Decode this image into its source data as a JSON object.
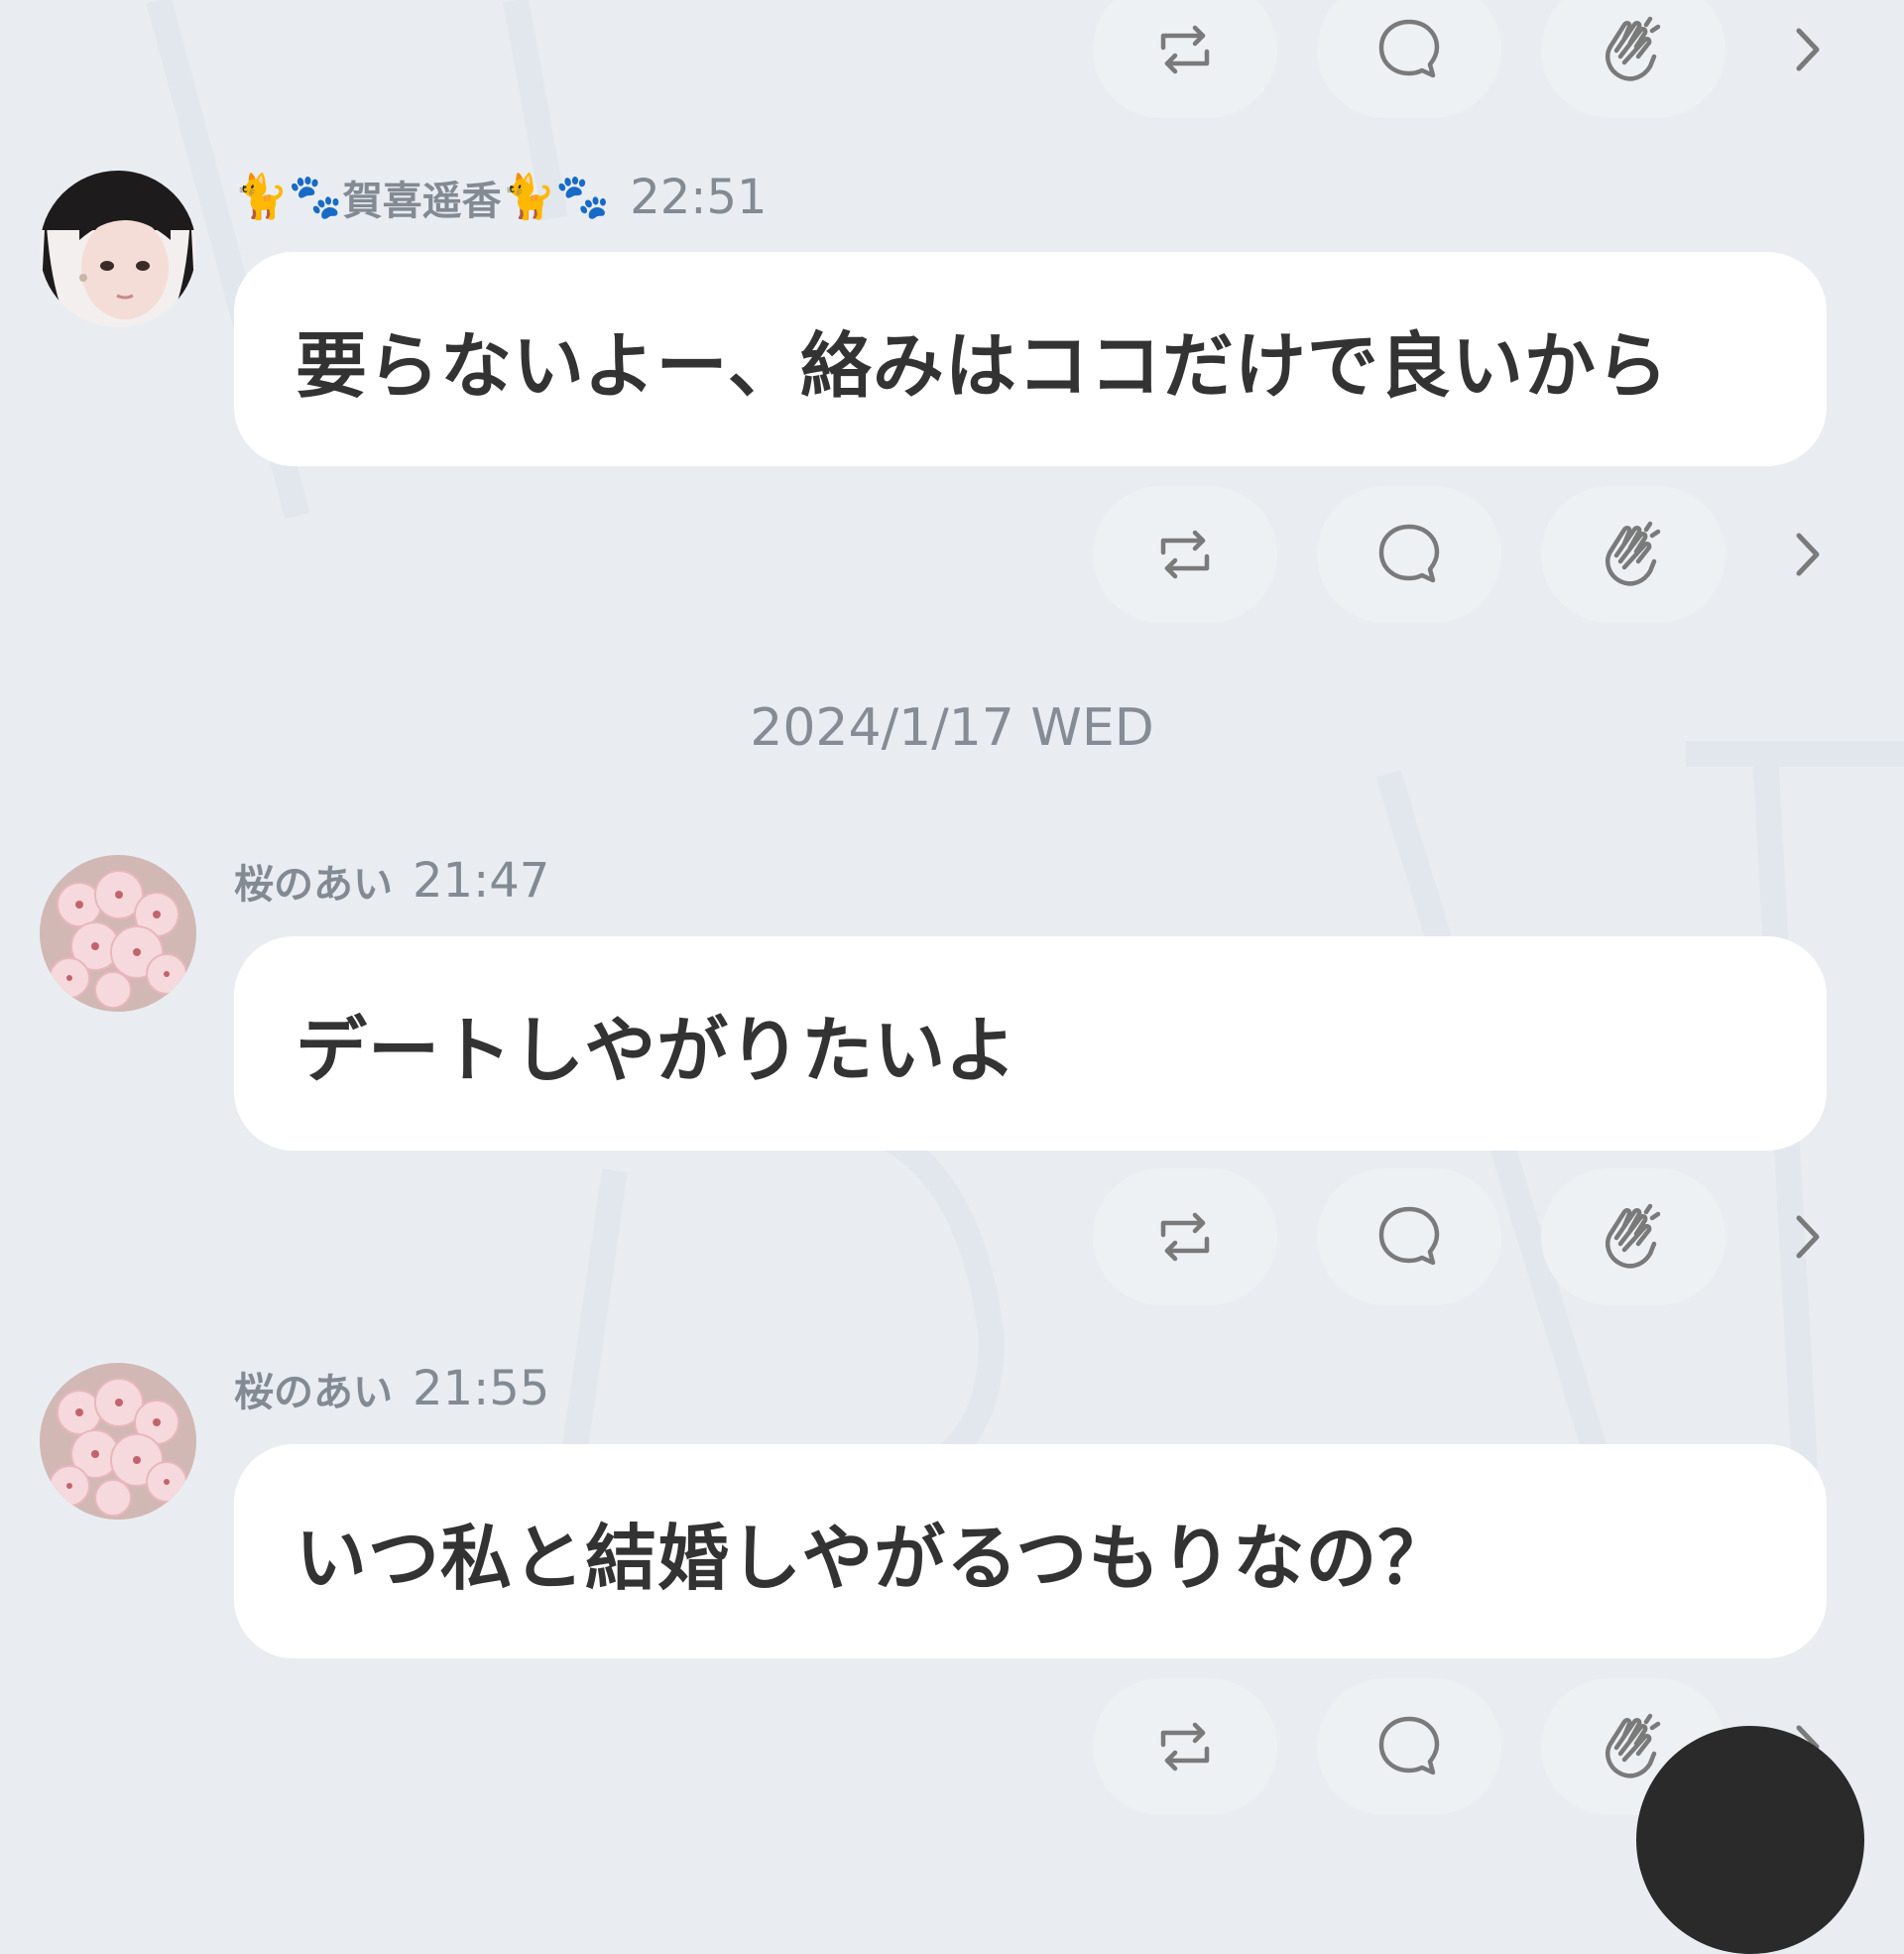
{
  "icons": {
    "repost": "repost-icon",
    "comment": "comment-icon",
    "clap": "clap-icon",
    "chevron": "chevron-right-icon"
  },
  "posts": [
    {
      "author": "賀喜遥香",
      "author_prefix_emoji": "🐈🐾",
      "author_suffix_emoji": "🐈🐾",
      "time": "22:51",
      "text": "要らないよー、絡みはココだけで良いから",
      "avatar": "photo-avatar"
    },
    {
      "author": "桜のあい",
      "time": "21:47",
      "text": "デートしやがりたいよ",
      "avatar": "sakura-avatar"
    },
    {
      "author": "桜のあい",
      "time": "21:55",
      "text": "いつ私と結婚しやがるつもりなの？",
      "avatar": "sakura-avatar"
    }
  ],
  "date_separator": "2024/1/17 WED",
  "colors": {
    "background": "#e9edf2",
    "bubble": "#ffffff",
    "pill": "#eef1f4",
    "meta_text": "#828a93",
    "message_text": "#333333"
  }
}
